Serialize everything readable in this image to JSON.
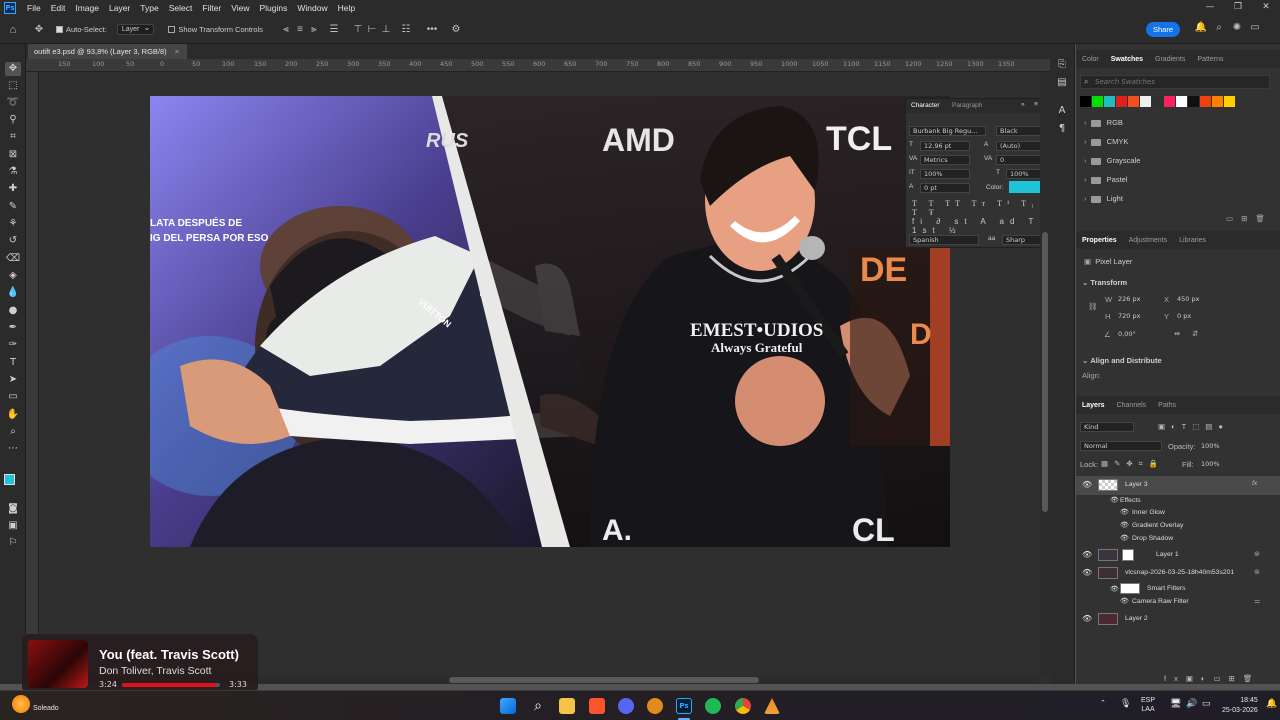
{
  "menubar": {
    "logo": "Ps",
    "items": [
      "File",
      "Edit",
      "Image",
      "Layer",
      "Type",
      "Select",
      "Filter",
      "View",
      "Plugins",
      "Window",
      "Help"
    ],
    "window_controls": [
      "—",
      "❐",
      "✕"
    ]
  },
  "options_bar": {
    "auto_select_label": "Auto-Select:",
    "auto_select_value": "Layer",
    "show_transform_label": "Show Transform Controls",
    "more": "•••",
    "share_label": "Share"
  },
  "document_tab": {
    "title": "outift e3.psd @ 93,8% (Layer 3, RGB/8)",
    "close": "×"
  },
  "ruler_labels": [
    "150",
    "100",
    "50",
    "0",
    "50",
    "100",
    "150",
    "200",
    "250",
    "300",
    "350",
    "400",
    "450",
    "500",
    "550",
    "600",
    "650",
    "700",
    "750",
    "800",
    "850",
    "900",
    "950",
    "1000",
    "1050",
    "1100",
    "1150",
    "1200",
    "1250",
    "1300",
    "1350"
  ],
  "canvas_text": {
    "subtitle_line1": "LATA DESPUÉS DE",
    "subtitle_line2": "IG DEL PERSA POR ESO",
    "logo_rus": "RUS",
    "logo_amd": "AMD",
    "logo_tcl": "TCL",
    "hoodie_line1": "EMEST•UDIOS",
    "hoodie_line2": "Always Grateful",
    "shoe_text": "VUITTON",
    "bottom_left": "A.",
    "bottom_right": "CL",
    "sign_letters": "DE",
    "sign_letter2": "D"
  },
  "character_panel": {
    "tabs": [
      "Character",
      "Paragraph"
    ],
    "font_family": "Burbank Big Regu...",
    "font_style": "Black",
    "size": "12,96 pt",
    "leading": "(Auto)",
    "kerning": "Metrics",
    "tracking": "0",
    "vscale": "100%",
    "hscale": "100%",
    "baseline": "0 pt",
    "color_label": "Color:",
    "color_value": "#1fc2d6",
    "language": "Spanish",
    "antialias": "Sharp"
  },
  "swatches": {
    "tabs": [
      "Color",
      "Swatches",
      "Gradients",
      "Patterns"
    ],
    "search_placeholder": "Search Swatches",
    "colors": [
      "#000000",
      "#00e000",
      "#1fbfbf",
      "#e02020",
      "#f05020",
      "#f0f0f0",
      "#303030",
      "#ff2060",
      "#ffffff",
      "#101010",
      "#f04010",
      "#ff8000",
      "#ffd000"
    ],
    "groups": [
      "RGB",
      "CMYK",
      "Grayscale",
      "Pastel",
      "Light"
    ]
  },
  "properties": {
    "tabs": [
      "Properties",
      "Adjustments",
      "Libraries"
    ],
    "layer_type": "Pixel Layer",
    "transform_title": "Transform",
    "w_label": "W",
    "w_value": "226 px",
    "x_label": "X",
    "x_value": "450 px",
    "h_label": "H",
    "h_value": "720 px",
    "y_label": "Y",
    "y_value": "0 px",
    "angle_value": "0,00°",
    "align_title": "Align and Distribute",
    "align_label": "Align:"
  },
  "layers": {
    "tabs": [
      "Layers",
      "Channels",
      "Paths"
    ],
    "filter_kind": "Kind",
    "blend_mode": "Normal",
    "opacity_label": "Opacity:",
    "opacity_value": "100%",
    "lock_label": "Lock:",
    "fill_label": "Fill:",
    "fill_value": "100%",
    "items": [
      {
        "name": "Layer 3",
        "fx": "fx"
      },
      {
        "name": "Effects"
      },
      {
        "name": "Inner Glow"
      },
      {
        "name": "Gradient Overlay"
      },
      {
        "name": "Drop Shadow"
      },
      {
        "name": "Layer 1"
      },
      {
        "name": "vlcsnap-2026-03-25-18h40m53s201"
      },
      {
        "name": "Smart Filters"
      },
      {
        "name": "Camera Raw Filter"
      },
      {
        "name": "Layer 2"
      }
    ]
  },
  "now_playing": {
    "title": "You (feat. Travis Scott)",
    "artist": "Don Toliver, Travis Scott",
    "elapsed": "3:24",
    "duration": "3:33",
    "progress": 0.96,
    "accent": "#e0121d"
  },
  "taskbar": {
    "weather": "Soleado",
    "lang_line1": "ESP",
    "lang_line2": "LAA",
    "time": "18:45",
    "date": "25-03-2026"
  }
}
